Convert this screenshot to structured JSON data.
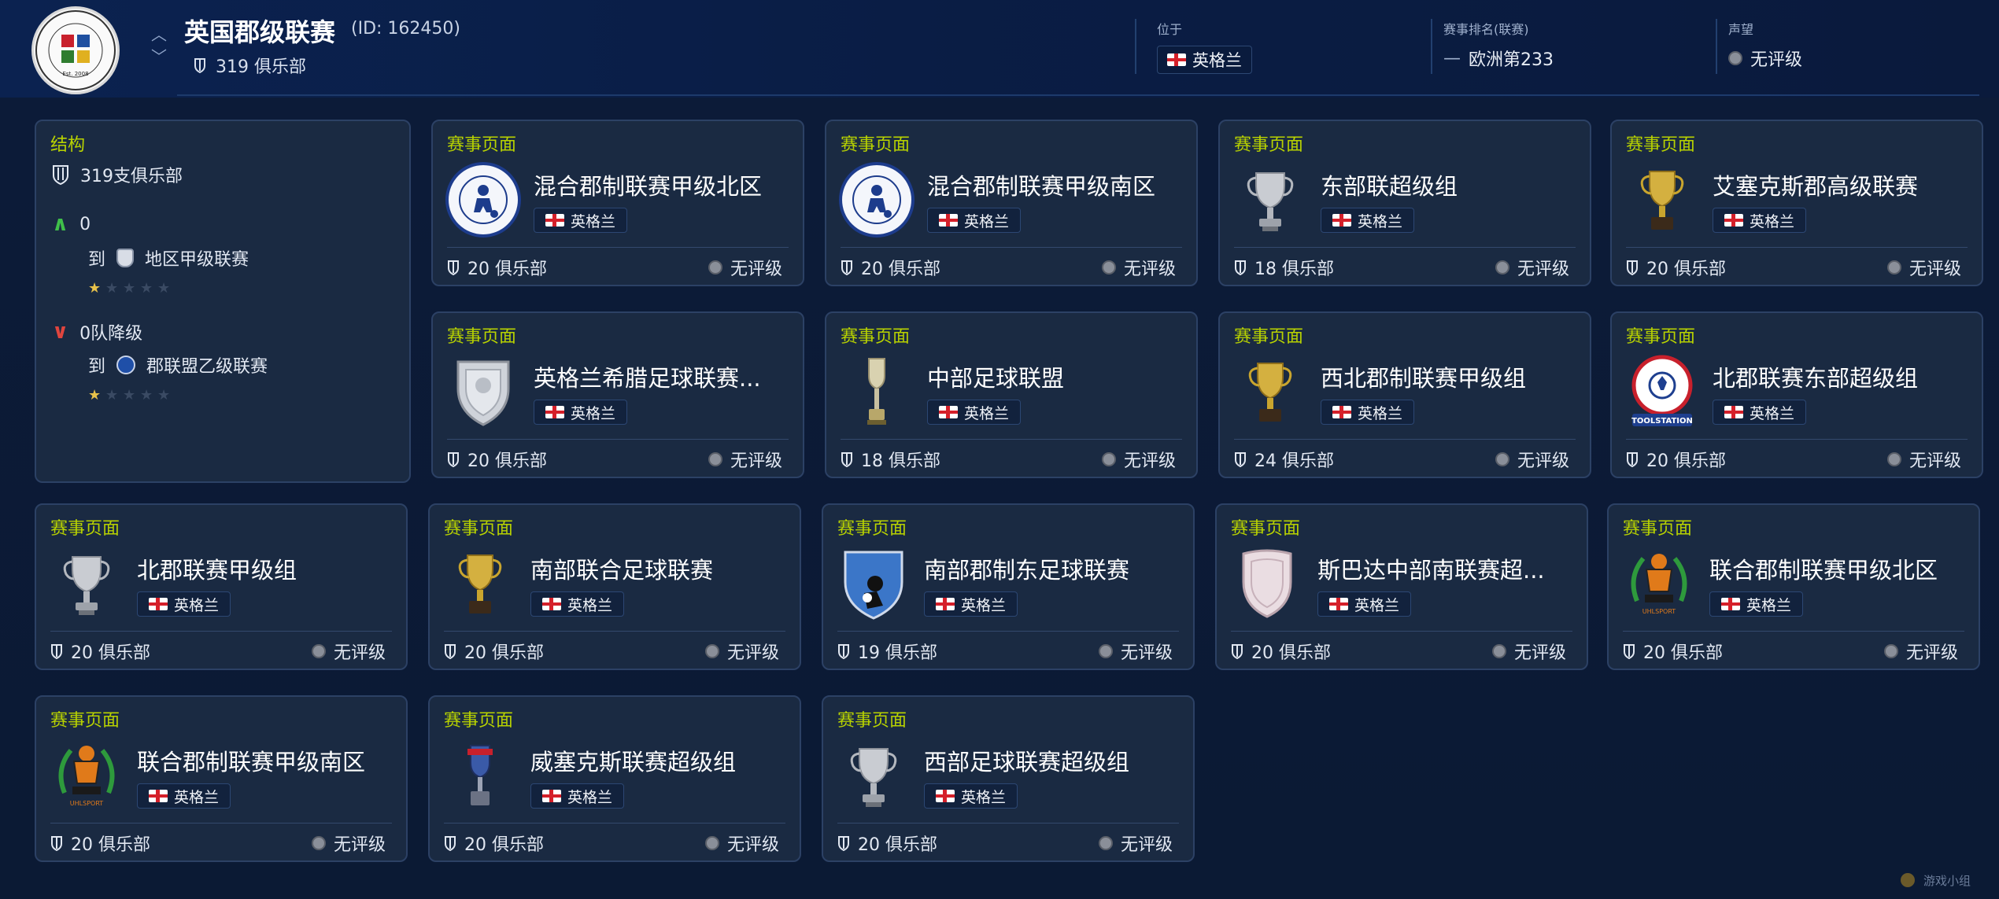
{
  "header": {
    "title": "英国郡级联赛",
    "id_label": "(ID: 162450)",
    "club_count": "319 俱乐部",
    "location_label": "位于",
    "location_value": "英格兰",
    "ranking_label": "赛事排名(联赛)",
    "ranking_value": "欧洲第233",
    "reputation_label": "声望",
    "reputation_value": "无评级",
    "logo_text_top": "COMBINED COUNTIES FOOTBALL LEAGUE",
    "logo_text_bottom": "Est. 2008"
  },
  "structure": {
    "title": "结构",
    "clubs": "319支俱乐部",
    "promotion_count": "0",
    "promotion_to_label": "到",
    "promotion_target": "地区甲级联赛",
    "relegation_count": "0队降级",
    "relegation_to_label": "到",
    "relegation_target": "郡联盟乙级联赛",
    "promotion_stars": 0.5,
    "relegation_stars": 0.5
  },
  "cards": [
    {
      "section": "赛事页面",
      "name": "混合郡制联赛甲级北区",
      "country": "英格兰",
      "clubs": "20 俱乐部",
      "rating": "无评级",
      "logo": "ccfl-badge"
    },
    {
      "section": "赛事页面",
      "name": "混合郡制联赛甲级南区",
      "country": "英格兰",
      "clubs": "20 俱乐部",
      "rating": "无评级",
      "logo": "ccfl-badge"
    },
    {
      "section": "赛事页面",
      "name": "东部联超级组",
      "country": "英格兰",
      "clubs": "18 俱乐部",
      "rating": "无评级",
      "logo": "silver-trophy"
    },
    {
      "section": "赛事页面",
      "name": "艾塞克斯郡高级联赛",
      "country": "英格兰",
      "clubs": "20 俱乐部",
      "rating": "无评级",
      "logo": "gold-trophy"
    },
    {
      "section": "赛事页面",
      "name": "英格兰希腊足球联赛...",
      "country": "英格兰",
      "clubs": "20 俱乐部",
      "rating": "无评级",
      "logo": "silver-shield"
    },
    {
      "section": "赛事页面",
      "name": "中部足球联盟",
      "country": "英格兰",
      "clubs": "18 俱乐部",
      "rating": "无评级",
      "logo": "tall-trophy"
    },
    {
      "section": "赛事页面",
      "name": "西北郡制联赛甲级组",
      "country": "英格兰",
      "clubs": "24 俱乐部",
      "rating": "无评级",
      "logo": "gold-trophy"
    },
    {
      "section": "赛事页面",
      "name": "北郡联赛东部超级组",
      "country": "英格兰",
      "clubs": "20 俱乐部",
      "rating": "无评级",
      "logo": "toolstation-badge"
    },
    {
      "section": "赛事页面",
      "name": "北郡联赛甲级组",
      "country": "英格兰",
      "clubs": "20 俱乐部",
      "rating": "无评级",
      "logo": "silver-trophy"
    },
    {
      "section": "赛事页面",
      "name": "南部联合足球联赛",
      "country": "英格兰",
      "clubs": "20 俱乐部",
      "rating": "无评级",
      "logo": "gold-trophy"
    },
    {
      "section": "赛事页面",
      "name": "南部郡制东足球联赛",
      "country": "英格兰",
      "clubs": "19 俱乐部",
      "rating": "无评级",
      "logo": "blue-shield"
    },
    {
      "section": "赛事页面",
      "name": "斯巴达中部南联赛超...",
      "country": "英格兰",
      "clubs": "20 俱乐部",
      "rating": "无评级",
      "logo": "pink-shield"
    },
    {
      "section": "赛事页面",
      "name": "联合郡制联赛甲级北区",
      "country": "英格兰",
      "clubs": "20 俱乐部",
      "rating": "无评级",
      "logo": "ucl-badge"
    },
    {
      "section": "赛事页面",
      "name": "联合郡制联赛甲级南区",
      "country": "英格兰",
      "clubs": "20 俱乐部",
      "rating": "无评级",
      "logo": "ucl-badge"
    },
    {
      "section": "赛事页面",
      "name": "威塞克斯联赛超级组",
      "country": "英格兰",
      "clubs": "20 俱乐部",
      "rating": "无评级",
      "logo": "blue-trophy"
    },
    {
      "section": "赛事页面",
      "name": "西部足球联赛超级组",
      "country": "英格兰",
      "clubs": "20 俱乐部",
      "rating": "无评级",
      "logo": "silver-trophy"
    }
  ],
  "logo_texts": {
    "toolstation": "TOOLSTATION",
    "ucl": "UHLSPORT"
  },
  "watermark": "游戏小组"
}
